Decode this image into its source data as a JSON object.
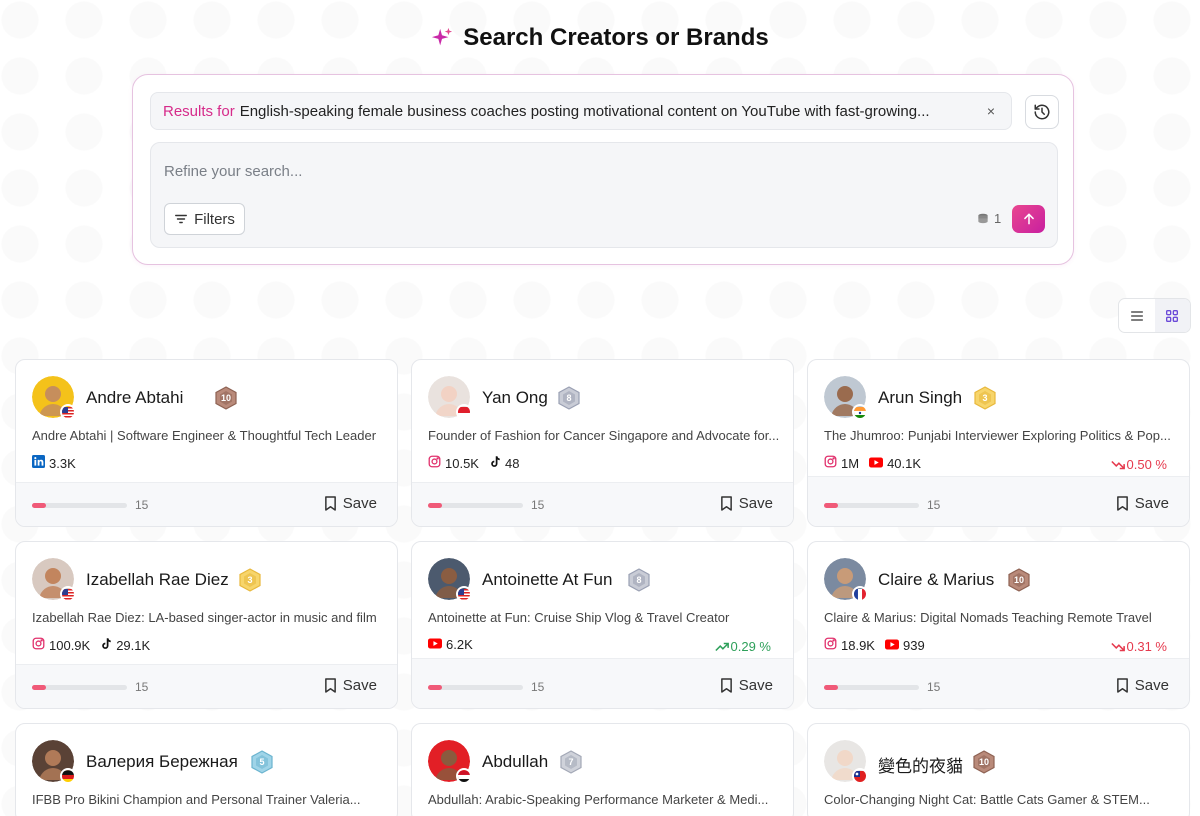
{
  "header": {
    "title": "Search Creators or Brands"
  },
  "search": {
    "results_prefix": "Results for",
    "query": "English-speaking female business coaches posting motivational content on YouTube with fast-growing...",
    "close_glyph": "×",
    "refine_placeholder": "Refine your search...",
    "filters_label": "Filters",
    "credits": "1"
  },
  "colors": {
    "accent": "#d62b8a",
    "submit_start": "#e9478f",
    "submit_end": "#c81fa0",
    "trend_down": "#e5394d",
    "trend_up": "#2ea05a"
  },
  "cards": [
    {
      "name": "Andre Abtahi",
      "level": "10",
      "bio": "Andre Abtahi | Software Engineer & Thoughtful Tech Leader",
      "stat1_icon": "linkedin-icon",
      "stat1": "3.3K",
      "stat2_icon": "",
      "stat2": "",
      "trend": "",
      "score": "15",
      "save": "Save",
      "flag": "us",
      "progress": 0.15
    },
    {
      "name": "Yan Ong",
      "level": "8",
      "bio": "Founder of Fashion for Cancer Singapore and Advocate for...",
      "stat1_icon": "instagram-icon",
      "stat1": "10.5K",
      "stat2_icon": "tiktok-icon",
      "stat2": "48",
      "trend": "",
      "score": "15",
      "save": "Save",
      "flag": "sg",
      "progress": 0.15
    },
    {
      "name": "Arun Singh",
      "level": "3",
      "bio": "The Jhumroo: Punjabi Interviewer Exploring Politics & Pop...",
      "stat1_icon": "instagram-icon",
      "stat1": "1M",
      "stat2_icon": "youtube-icon",
      "stat2": "40.1K",
      "trend": "0.50 %",
      "trend_dir": "down",
      "score": "15",
      "save": "Save",
      "flag": "in",
      "progress": 0.15
    },
    {
      "name": "Izabellah Rae Diez",
      "level": "3",
      "bio": "Izabellah Rae Diez: LA-based singer-actor in music and film",
      "stat1_icon": "instagram-icon",
      "stat1": "100.9K",
      "stat2_icon": "tiktok-icon",
      "stat2": "29.1K",
      "trend": "",
      "score": "15",
      "save": "Save",
      "flag": "us",
      "progress": 0.15
    },
    {
      "name": "Antoinette At Fun",
      "level": "8",
      "bio": "Antoinette at Fun: Cruise Ship Vlog & Travel Creator",
      "stat1_icon": "youtube-icon",
      "stat1": "6.2K",
      "stat2_icon": "",
      "stat2": "",
      "trend": "0.29 %",
      "trend_dir": "up",
      "score": "15",
      "save": "Save",
      "flag": "us",
      "progress": 0.15
    },
    {
      "name": "Claire & Marius",
      "level": "10",
      "bio": "Claire & Marius: Digital Nomads Teaching Remote Travel",
      "stat1_icon": "instagram-icon",
      "stat1": "18.9K",
      "stat2_icon": "youtube-icon",
      "stat2": "939",
      "trend": "0.31 %",
      "trend_dir": "down",
      "score": "15",
      "save": "Save",
      "flag": "fr",
      "progress": 0.15
    },
    {
      "name": "Валерия Бережная",
      "level": "5",
      "bio": "IFBB Pro Bikini Champion and Personal Trainer Valeria...",
      "flag": "de"
    },
    {
      "name": "Abdullah",
      "level": "7",
      "bio": "Abdullah: Arabic-Speaking Performance Marketer & Medi...",
      "flag": "eg"
    },
    {
      "name": "變色的夜貓",
      "level": "10",
      "bio": "Color-Changing Night Cat: Battle Cats Gamer & STEM...",
      "flag": "tw"
    }
  ]
}
